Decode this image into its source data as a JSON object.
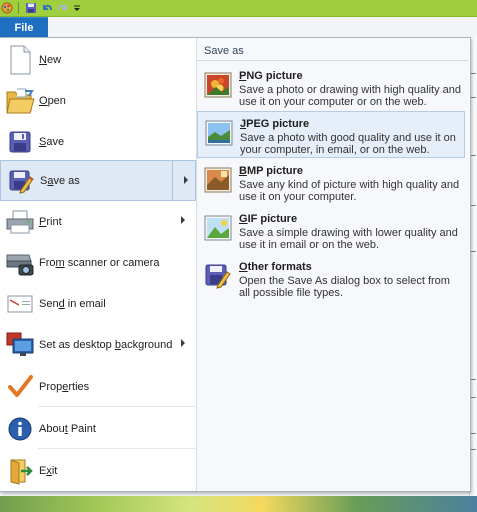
{
  "window": {
    "accent": "#9fce3e",
    "file_tab_color": "#1f6fc0"
  },
  "qat": {
    "icons": [
      "app-icon",
      "save-icon",
      "undo-icon",
      "redo-icon",
      "customize-icon"
    ]
  },
  "file_tab": {
    "label": "File"
  },
  "left_menu": {
    "items": [
      {
        "label": "New",
        "accel": "N",
        "icon": "new-document-icon",
        "submenu": false
      },
      {
        "label": "Open",
        "accel": "O",
        "icon": "open-folder-icon",
        "submenu": false
      },
      {
        "label": "Save",
        "accel": "S",
        "icon": "save-icon",
        "submenu": false
      },
      {
        "label": "Save as",
        "accel": "a",
        "icon": "save-as-icon",
        "submenu": true,
        "selected": true
      },
      {
        "label": "Print",
        "accel": "P",
        "icon": "printer-icon",
        "submenu": true
      },
      {
        "label": "From scanner or camera",
        "accel": "m",
        "icon": "scanner-camera-icon",
        "submenu": false
      },
      {
        "label": "Send in email",
        "accel": "d",
        "icon": "email-icon",
        "submenu": false
      },
      {
        "label": "Set as desktop background",
        "accel": "b",
        "icon": "desktop-background-icon",
        "submenu": true
      },
      {
        "label": "Properties",
        "accel": "e",
        "icon": "checkmark-icon",
        "submenu": false
      },
      {
        "label": "About Paint",
        "accel": "t",
        "icon": "info-icon",
        "submenu": false
      },
      {
        "label": "Exit",
        "accel": "x",
        "icon": "exit-icon",
        "submenu": false
      }
    ]
  },
  "save_as_pane": {
    "header": "Save as",
    "options": [
      {
        "title": "PNG picture",
        "accel": "P",
        "description": "Save a photo or drawing with high quality and use it on your computer or on the web.",
        "icon": "png-picture-icon"
      },
      {
        "title": "JPEG picture",
        "accel": "J",
        "description": "Save a photo with good quality and use it on your computer, in email, or on the web.",
        "icon": "jpeg-picture-icon",
        "selected": true
      },
      {
        "title": "BMP picture",
        "accel": "B",
        "description": "Save any kind of picture with high quality and use it on your computer.",
        "icon": "bmp-picture-icon"
      },
      {
        "title": "GIF picture",
        "accel": "G",
        "description": "Save a simple drawing with lower quality and use it in email or on the web.",
        "icon": "gif-picture-icon"
      },
      {
        "title": "Other formats",
        "accel": "O",
        "description": "Open the Save As dialog box to select from all possible file types.",
        "icon": "other-formats-icon"
      }
    ]
  }
}
